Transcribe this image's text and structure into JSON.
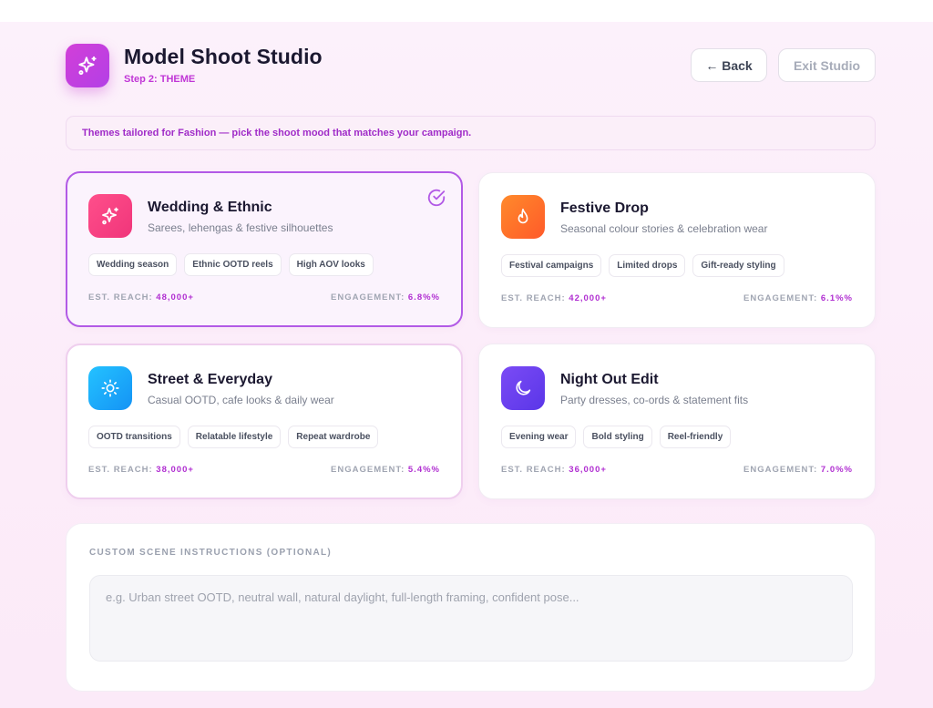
{
  "header": {
    "title": "Model Shoot Studio",
    "step": "Step 2: THEME",
    "back_label": "← Back",
    "exit_label": "Exit Studio",
    "logo_icon": "sparkles-icon",
    "brand_color": "#c73ed8"
  },
  "banner": {
    "text": "Themes tailored for Fashion — pick the shoot mood that matches your campaign."
  },
  "themes": [
    {
      "title": "Wedding & Ethnic",
      "subtitle": "Sarees, lehengas & festive silhouettes",
      "icon": "sparkles-icon",
      "icon_gradient": [
        "#ff4f8b",
        "#f0357a"
      ],
      "tags": [
        "Wedding season",
        "Ethnic OOTD reels",
        "High AOV looks"
      ],
      "reach_label": "EST. REACH:",
      "reach_value": "48,000+",
      "engagement_label": "ENGAGEMENT:",
      "engagement_value": "6.8%%",
      "selected": true
    },
    {
      "title": "Festive Drop",
      "subtitle": "Seasonal colour stories & celebration wear",
      "icon": "flame-icon",
      "icon_gradient": [
        "#ff8a2b",
        "#ff5a2a"
      ],
      "tags": [
        "Festival campaigns",
        "Limited drops",
        "Gift-ready styling"
      ],
      "reach_label": "EST. REACH:",
      "reach_value": "42,000+",
      "engagement_label": "ENGAGEMENT:",
      "engagement_value": "6.1%%",
      "selected": false
    },
    {
      "title": "Street & Everyday",
      "subtitle": "Casual OOTD, cafe looks & daily wear",
      "icon": "sun-icon",
      "icon_gradient": [
        "#24c2ff",
        "#1493f5"
      ],
      "tags": [
        "OOTD transitions",
        "Relatable lifestyle",
        "Repeat wardrobe"
      ],
      "reach_label": "EST. REACH:",
      "reach_value": "38,000+",
      "engagement_label": "ENGAGEMENT:",
      "engagement_value": "5.4%%",
      "selected": false
    },
    {
      "title": "Night Out Edit",
      "subtitle": "Party dresses, co-ords & statement fits",
      "icon": "moon-icon",
      "icon_gradient": [
        "#7b4bf5",
        "#5a36e8"
      ],
      "tags": [
        "Evening wear",
        "Bold styling",
        "Reel-friendly"
      ],
      "reach_label": "EST. REACH:",
      "reach_value": "36,000+",
      "engagement_label": "ENGAGEMENT:",
      "engagement_value": "7.0%%",
      "selected": false
    }
  ],
  "custom": {
    "label": "CUSTOM SCENE INSTRUCTIONS (OPTIONAL)",
    "placeholder": "e.g. Urban street OOTD, neutral wall, natural daylight, full-length framing, confident pose...",
    "value": ""
  }
}
